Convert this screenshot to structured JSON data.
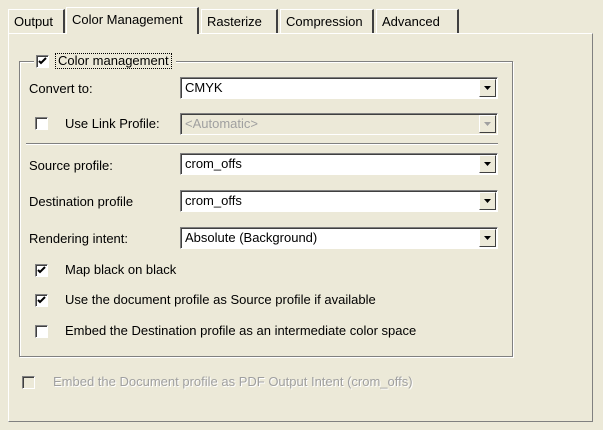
{
  "tabs": [
    {
      "label": "Output"
    },
    {
      "label": "Color Management"
    },
    {
      "label": "Rasterize"
    },
    {
      "label": "Compression"
    },
    {
      "label": "Advanced"
    }
  ],
  "active_tab": "Color Management",
  "color_management": {
    "group_label": "Color management",
    "group_checked": true,
    "convert_to": {
      "label": "Convert to:",
      "value": "CMYK"
    },
    "use_link_profile": {
      "label": "Use Link Profile:",
      "checked": false,
      "value": "<Automatic>",
      "enabled": false
    },
    "source_profile": {
      "label": "Source profile:",
      "value": "crom_offs"
    },
    "destination_profile": {
      "label": "Destination profile",
      "value": "crom_offs"
    },
    "rendering_intent": {
      "label": "Rendering intent:",
      "value": "Absolute (Background)"
    },
    "map_black": {
      "label": "Map black on black",
      "checked": true
    },
    "use_document_profile": {
      "label": "Use the document profile as Source profile if available",
      "checked": true
    },
    "embed_destination": {
      "label": "Embed the Destination profile as an intermediate color space",
      "checked": false
    }
  },
  "embed_document_profile": {
    "label": "Embed the Document profile as PDF Output Intent (crom_offs)",
    "checked": false,
    "enabled": false
  },
  "icons": {
    "check": "check-icon",
    "dropdown": "chevron-down-icon"
  },
  "colors": {
    "background": "#ece9d8",
    "disabled_text": "#a0a0a0"
  }
}
